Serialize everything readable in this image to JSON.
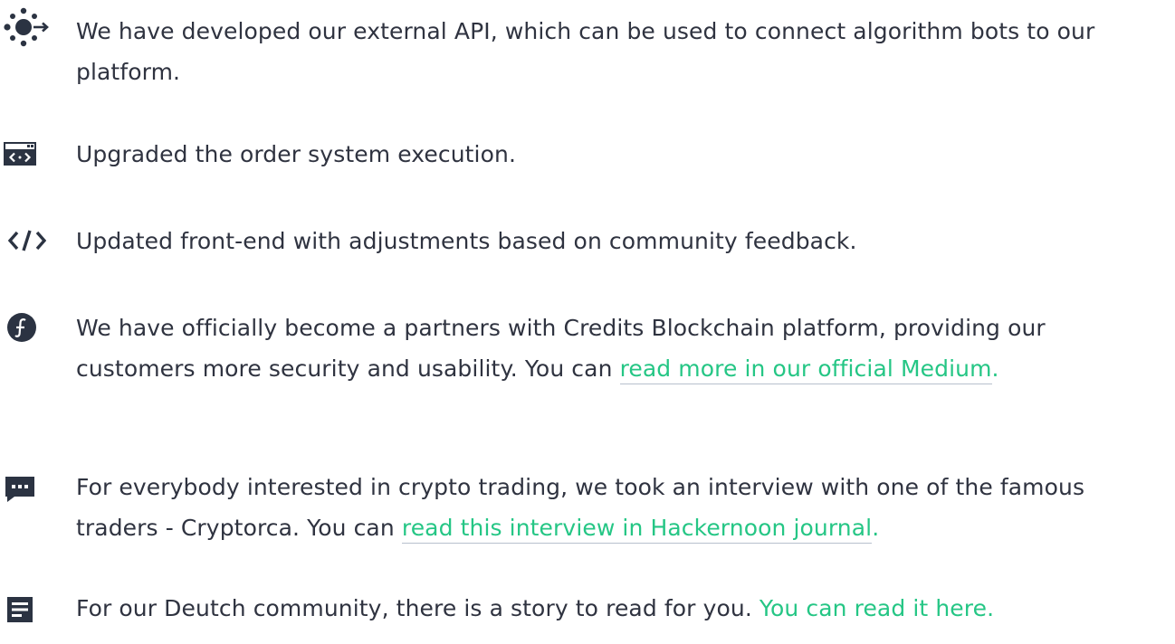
{
  "colors": {
    "text": "#2f3340",
    "link": "#25c685",
    "icon": "#2b3342",
    "underline": "#b7c0cd",
    "background": "#ffffff"
  },
  "items": [
    {
      "icon": "network-nodes-icon",
      "text": "We have developed our external API, which can be used to connect algorithm bots to our platform."
    },
    {
      "icon": "code-window-icon",
      "text": "Upgraded the order system execution."
    },
    {
      "icon": "code-brackets-icon",
      "text": "Updated front-end with adjustments based on community feedback."
    },
    {
      "icon": "credits-coin-icon",
      "text_before": "We have officially become a partners with Credits Blockchain platform, providing our customers more security and usability. You can ",
      "link": "read more in our official Medium",
      "text_after": "."
    },
    {
      "icon": "chat-bubble-icon",
      "text_before": "For everybody interested in crypto trading, we took an interview with one of the famous traders - Cryptorca. You can ",
      "link": "read this interview in Hackernoon journal",
      "text_after": "."
    },
    {
      "icon": "document-icon",
      "text_before": "For our Deutch community, there is a story to read for you. ",
      "link": "You can read it here.",
      "text_after": ""
    }
  ]
}
